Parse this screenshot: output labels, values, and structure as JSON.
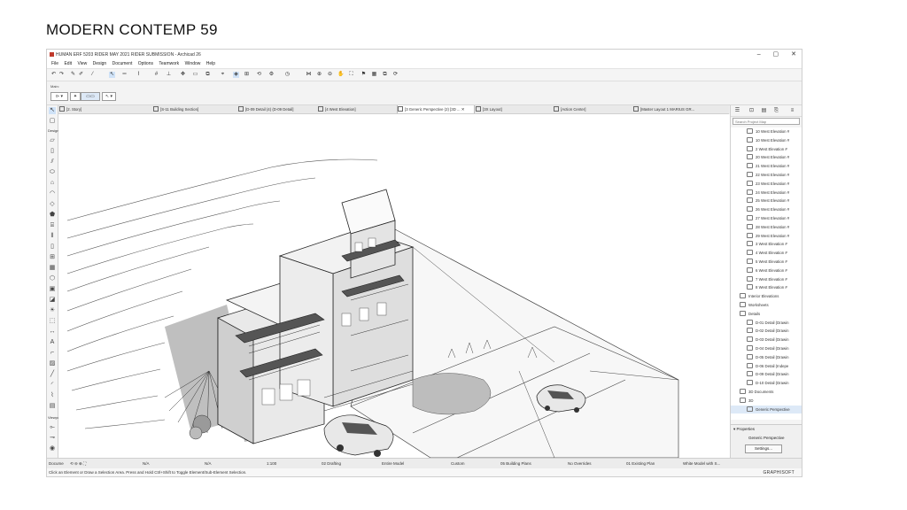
{
  "slide": {
    "title": "MODERN CONTEMP  59"
  },
  "window": {
    "title": "HUMAN ERF 5203 RIDER MAY 2021 RIDER SUBMISSION - Archicad 26",
    "controls": [
      "–",
      "▢",
      "✕"
    ]
  },
  "menu": [
    "File",
    "Edit",
    "View",
    "Design",
    "Document",
    "Options",
    "Teamwork",
    "Window",
    "Help"
  ],
  "infobox": {
    "label": "Main:"
  },
  "tabs": [
    {
      "label": "[2. Story]"
    },
    {
      "label": "[S-11 Building Section]"
    },
    {
      "label": "[D-09 Detail (4) (D-09 Detail]"
    },
    {
      "label": "[4 West Elevation]"
    },
    {
      "label": "[3 Generic Perspective (2) [3D ...",
      "active": true
    },
    {
      "label": "[3X Layout]"
    },
    {
      "label": "[Action Center]"
    },
    {
      "label": "[Master Layout 1 MARIUS GR..."
    }
  ],
  "toolbox": {
    "design_label": "Design",
    "viewpoint_label": "Viewpoi"
  },
  "navigator": {
    "search_placeholder": "Search Project Map",
    "items": [
      "10 West Elevation #",
      "10 West Elevation #",
      "2 West Elevation #",
      "20 West Elevation #",
      "21 West Elevation #",
      "22 West Elevation #",
      "23 West Elevation #",
      "24 West Elevation #",
      "25 West Elevation #",
      "26 West Elevation #",
      "27 West Elevation #",
      "28 West Elevation #",
      "29 West Elevation #",
      "3 West Elevation #",
      "4 West Elevation #",
      "5 West Elevation #",
      "6 West Elevation #",
      "7 West Elevation #",
      "8 West Elevation #",
      "Interior Elevations",
      "Worksheets",
      "Details",
      "D-01 Detail (Drawin",
      "D-02 Detail (Drawin",
      "D-03 Detail (Drawin",
      "D-04 Detail (Drawin",
      "D-05 Detail (Drawin",
      "D-06 Detail (Indepe",
      "D-09 Detail (Drawin",
      "D-10 Detail (Drawin",
      "3D Documents",
      "3D",
      "Generic Perspective"
    ]
  },
  "properties": {
    "header": "Properties",
    "value": "Generic Perspective",
    "settings_button": "Settings..."
  },
  "statusbar": {
    "doc_label": "Docume",
    "zoom_a": "N/A",
    "zoom_b": "N/A",
    "scale": "1:100",
    "layer": "02 Drafting",
    "model": "Entire Model",
    "pen": "Custom",
    "plans": "05 Building Plans",
    "overrides": "No Overrides",
    "renovation": "01 Existing Plan",
    "style": "White Model with S..."
  },
  "message": "Click an Element or Draw a Selection Area. Press and Hold Ctrl+Shift to Toggle Element/Sub-Element Selection.",
  "brand": "GRAPHISOFT",
  "colors": {
    "accent": "#2b78d0",
    "app_icon": "#c0392b"
  }
}
